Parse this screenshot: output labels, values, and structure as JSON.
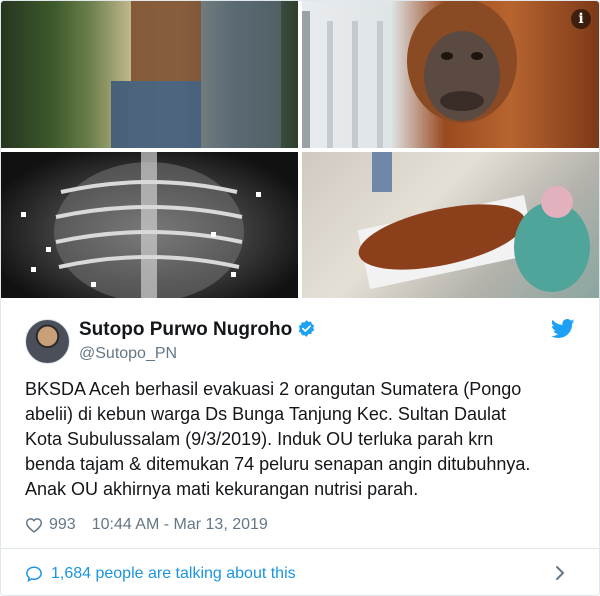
{
  "media": {
    "photos": [
      {
        "name": "rescue-photo"
      },
      {
        "name": "orangutan-portrait"
      },
      {
        "name": "xray-photo"
      },
      {
        "name": "surgery-photo"
      }
    ],
    "info_icon": "info-icon",
    "info_glyph": "i"
  },
  "author": {
    "display_name": "Sutopo Purwo Nugroho",
    "handle": "@Sutopo_PN",
    "verified": true
  },
  "tweet": {
    "text": "BKSDA Aceh berhasil evakuasi 2 orangutan Sumatera (Pongo\nabelii) di kebun warga Ds Bunga Tanjung Kec. Sultan Daulat\nKota Subulussalam (9/3/2019). Induk OU terluka parah krn\nbenda tajam & ditemukan 74 peluru senapan angin ditubuhnya.\nAnak OU akhirnya mati kekurangan nutrisi parah.",
    "likes": "993",
    "timestamp": "10:44 AM - Mar 13, 2019"
  },
  "footer": {
    "talking_text": "1,684 people are talking about this"
  },
  "colors": {
    "accent": "#1b95e0",
    "secondary_text": "#657786",
    "border": "#e1e8ed"
  }
}
